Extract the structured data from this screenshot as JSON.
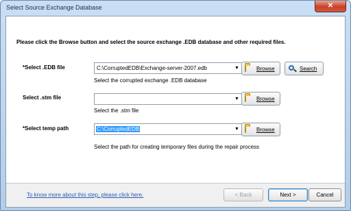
{
  "window": {
    "title": "Select Source Exchange Database",
    "close_glyph": "✕"
  },
  "instruction": "Please click the Browse button and select the source exchange .EDB database and other required files.",
  "edb": {
    "label": "*Select .EDB file",
    "value": "C:\\CorruptedEDB\\Exchange-server-2007.edb",
    "hint": "Select the corrupted exchange .EDB database",
    "browse_label": "Browse",
    "search_label": "Search"
  },
  "stm": {
    "label": "Select .stm file",
    "value": "",
    "hint": "Select the .stm file",
    "browse_label": "Browse"
  },
  "temp": {
    "label": "*Select temp path",
    "value": "C:\\CorruptedEDB",
    "hint": "Select the path for creating temporary files during the repair process",
    "browse_label": "Browse"
  },
  "footer": {
    "help_link": "To know more about this step, please click here.",
    "back_label": "< Back",
    "next_label": "Next >",
    "cancel_label": "Cancel"
  },
  "icons": {
    "dropdown": "chevron-down-icon",
    "browse": "folder-icon",
    "search": "magnifier-icon"
  },
  "colors": {
    "selection": "#3399ff",
    "link": "#2a5ab8",
    "close": "#c8402a"
  }
}
